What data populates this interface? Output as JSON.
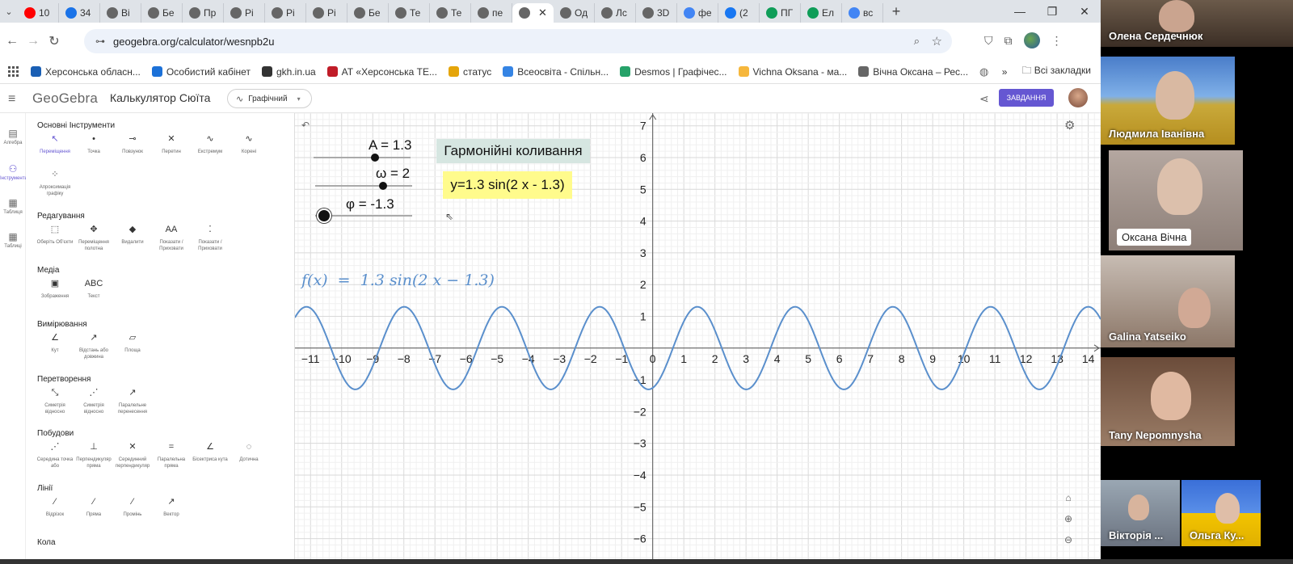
{
  "browser": {
    "tabs": [
      {
        "label": "10",
        "icon": "youtube-icon",
        "color": "#ff0000"
      },
      {
        "label": "34",
        "icon": "mail-icon",
        "color": "#1a73e8"
      },
      {
        "label": "Ві",
        "icon": "geogebra-icon",
        "color": "#666"
      },
      {
        "label": "Бе",
        "icon": "geogebra-icon",
        "color": "#666"
      },
      {
        "label": "Пр",
        "icon": "geogebra-icon",
        "color": "#666"
      },
      {
        "label": "Рі",
        "icon": "geogebra-icon",
        "color": "#666"
      },
      {
        "label": "Рі",
        "icon": "geogebra-icon",
        "color": "#666"
      },
      {
        "label": "Рі",
        "icon": "geogebra-icon",
        "color": "#666"
      },
      {
        "label": "Бе",
        "icon": "geogebra-icon",
        "color": "#666"
      },
      {
        "label": "Те",
        "icon": "geogebra-icon",
        "color": "#666"
      },
      {
        "label": "Те",
        "icon": "geogebra-icon",
        "color": "#666"
      },
      {
        "label": "пе",
        "icon": "geogebra-icon",
        "color": "#666"
      },
      {
        "label": "",
        "icon": "geogebra-icon",
        "color": "#666",
        "active": true
      },
      {
        "label": "Од",
        "icon": "geogebra-icon",
        "color": "#666"
      },
      {
        "label": "Лс",
        "icon": "geogebra-icon",
        "color": "#666"
      },
      {
        "label": "3D",
        "icon": "geogebra-icon",
        "color": "#666"
      },
      {
        "label": "фе",
        "icon": "google-icon",
        "color": "#4285f4"
      },
      {
        "label": "(2",
        "icon": "facebook-icon",
        "color": "#1877f2"
      },
      {
        "label": "ПГ",
        "icon": "sheets-icon",
        "color": "#0f9d58"
      },
      {
        "label": "Ел",
        "icon": "sheets-icon",
        "color": "#0f9d58"
      },
      {
        "label": "вс",
        "icon": "google-icon",
        "color": "#4285f4"
      }
    ],
    "url": "geogebra.org/calculator/wesnpb2u",
    "bookmarks": [
      {
        "label": "Херсонська обласн...",
        "color": "#1a5fb4"
      },
      {
        "label": "Особистий кабінет",
        "color": "#1c71d8"
      },
      {
        "label": "gkh.in.ua",
        "color": "#333333"
      },
      {
        "label": "АТ «Херсонська ТЕ...",
        "color": "#c01c28"
      },
      {
        "label": "статус",
        "color": "#e5a50a"
      },
      {
        "label": "Всеосвіта - Спільн...",
        "color": "#3584e4"
      },
      {
        "label": "Desmos | Графічес...",
        "color": "#26a269"
      },
      {
        "label": "Vichna Oksana - ма...",
        "color": "#f6b73c"
      },
      {
        "label": "Вічна Оксана – Рес...",
        "color": "#666666"
      }
    ],
    "all_bookmarks": "Всі закладки"
  },
  "geogebra": {
    "logo": "GeoGebra",
    "title": "Калькулятор Сюїта",
    "mode": "Графічний",
    "task_button": "ЗАВДАННЯ",
    "rail": [
      {
        "label": "Алгебра",
        "icon": "calculator-icon"
      },
      {
        "label": "Інструменти",
        "icon": "tools-icon",
        "active": true
      },
      {
        "label": "Таблиця",
        "icon": "table-icon"
      },
      {
        "label": "Таблиці",
        "icon": "table-icon"
      }
    ],
    "tool_sections": [
      {
        "title": "Основні Інструменти",
        "tools": [
          {
            "label": "Переміщення",
            "icon": "↖",
            "selected": true
          },
          {
            "label": "Точка",
            "icon": "•"
          },
          {
            "label": "Повзунок",
            "icon": "⊸"
          },
          {
            "label": "Перетин",
            "icon": "✕"
          },
          {
            "label": "Екстремум",
            "icon": "∿"
          },
          {
            "label": "Корені",
            "icon": "∿"
          },
          {
            "label": "Апроксимація графіку",
            "icon": "⁘"
          }
        ]
      },
      {
        "title": "Редагування",
        "tools": [
          {
            "label": "Оберіть Об'єкти",
            "icon": "⬚"
          },
          {
            "label": "Переміщення полотна",
            "icon": "✥"
          },
          {
            "label": "Видалити",
            "icon": "◆"
          },
          {
            "label": "Показати / Приховати",
            "icon": "AA"
          },
          {
            "label": "Показати / Приховати",
            "icon": "⁚"
          }
        ]
      },
      {
        "title": "Медіа",
        "tools": [
          {
            "label": "Зображення",
            "icon": "▣"
          },
          {
            "label": "Текст",
            "icon": "ABC"
          }
        ]
      },
      {
        "title": "Вимірювання",
        "tools": [
          {
            "label": "Кут",
            "icon": "∠"
          },
          {
            "label": "Відстань або довжина",
            "icon": "↗"
          },
          {
            "label": "Площа",
            "icon": "▱"
          }
        ]
      },
      {
        "title": "Перетворення",
        "tools": [
          {
            "label": "Симетрія відносно",
            "icon": "⤡"
          },
          {
            "label": "Симетрія відносно",
            "icon": "⋰"
          },
          {
            "label": "Паралельне перенесення",
            "icon": "↗"
          }
        ]
      },
      {
        "title": "Побудови",
        "tools": [
          {
            "label": "Середина точка або",
            "icon": "⋰"
          },
          {
            "label": "Перпендикуляр пряма",
            "icon": "⊥"
          },
          {
            "label": "Серединний перпендикуляр",
            "icon": "✕"
          },
          {
            "label": "Паралельна пряма",
            "icon": "="
          },
          {
            "label": "Бісектриса кута",
            "icon": "∠"
          },
          {
            "label": "Дотична",
            "icon": "◌"
          }
        ]
      },
      {
        "title": "Лінії",
        "tools": [
          {
            "label": "Відрізок",
            "icon": "⁄"
          },
          {
            "label": "Пряма",
            "icon": "⁄"
          },
          {
            "label": "Промінь",
            "icon": "⁄"
          },
          {
            "label": "Вектор",
            "icon": "↗"
          }
        ]
      },
      {
        "title": "Кола",
        "tools": []
      }
    ],
    "sliders": [
      {
        "label": "A = 1.3",
        "value": 1.3,
        "min": -5,
        "max": 5
      },
      {
        "label": "ω = 2",
        "value": 2,
        "min": -5,
        "max": 5
      },
      {
        "label": "φ = -1.3",
        "value": -1.3,
        "min": -2,
        "max": 6
      }
    ],
    "text_title": "Гармонійні коливання",
    "text_equation": "y=1.3 sin(2 x - 1.3)",
    "function_label": "f(x)  =  1.3 sin(2 x − 1.3)"
  },
  "chart_data": {
    "type": "line",
    "function": "f(x) = 1.3 sin(2x - 1.3)",
    "params": {
      "A": 1.3,
      "omega": 2,
      "phi": -1.3
    },
    "xlim": [
      -11.5,
      14.4
    ],
    "ylim": [
      -6.8,
      7.4
    ],
    "x_ticks": [
      -11,
      -10,
      -9,
      -8,
      -7,
      -6,
      -5,
      -4,
      -3,
      -2,
      -1,
      0,
      1,
      2,
      3,
      4,
      5,
      6,
      7,
      8,
      9,
      10,
      11,
      12,
      13,
      14
    ],
    "y_ticks": [
      -6,
      -5,
      -4,
      -3,
      -2,
      -1,
      1,
      2,
      3,
      4,
      5,
      6,
      7
    ],
    "grid": true,
    "line_color": "#5a8fcc"
  },
  "participants": [
    {
      "name": "Олена Сердечнюк"
    },
    {
      "name": "Людмила Іванівна"
    },
    {
      "name": "Оксана Вічна"
    },
    {
      "name": "Galina Yatseiko"
    },
    {
      "name": "Tany Nepomnysha"
    },
    {
      "name": "Вікторія ..."
    },
    {
      "name": "Ольга Ку..."
    }
  ]
}
